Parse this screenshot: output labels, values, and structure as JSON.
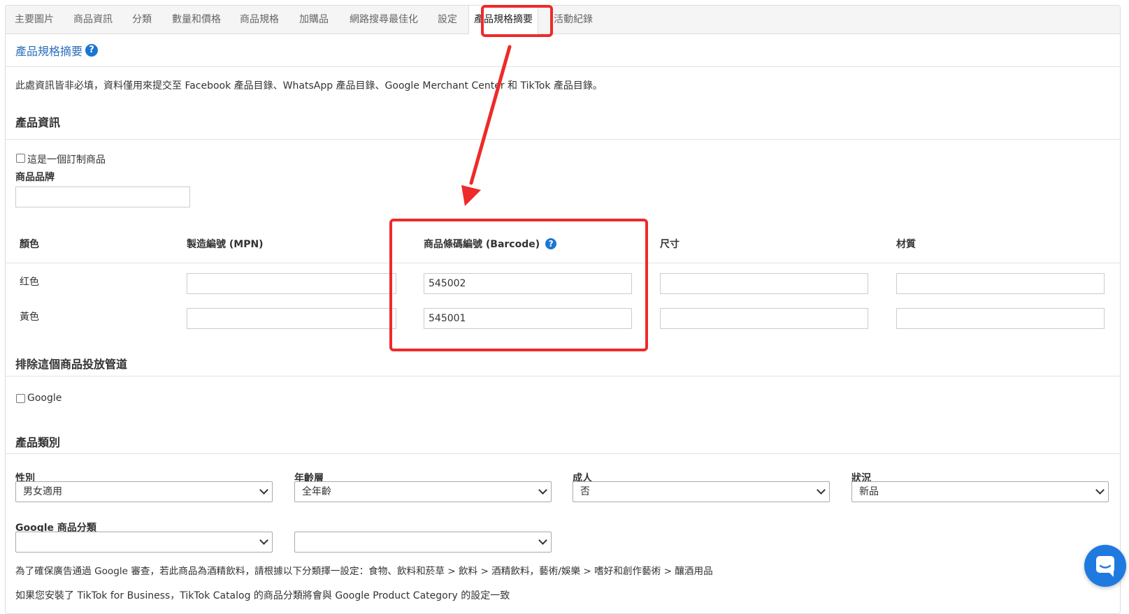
{
  "tabs": [
    {
      "label": "主要圖片"
    },
    {
      "label": "商品資訊"
    },
    {
      "label": "分類"
    },
    {
      "label": "數量和價格"
    },
    {
      "label": "商品規格"
    },
    {
      "label": "加購品"
    },
    {
      "label": "網路搜尋最佳化"
    },
    {
      "label": "設定"
    },
    {
      "label": "產品規格摘要",
      "active": true
    },
    {
      "label": "活動紀錄"
    }
  ],
  "panel_title": "產品規格摘要",
  "notice": "此處資訊皆非必填，資料僅用來提交至 Facebook 產品目錄、WhatsApp 產品目錄、Google Merchant Center 和 TikTok 產品目錄。",
  "product_info": {
    "heading": "產品資訊",
    "custom_product_label": "這是一個訂制商品",
    "brand_label": "商品品牌",
    "brand_value": ""
  },
  "variants_table": {
    "headers": {
      "color": "顏色",
      "mpn": "製造編號 (MPN)",
      "barcode": "商品條碼編號 (Barcode)",
      "size": "尺寸",
      "material": "材質"
    },
    "rows": [
      {
        "color": "红色",
        "mpn": "",
        "barcode": "545002",
        "size": "",
        "material": ""
      },
      {
        "color": "黃色",
        "mpn": "",
        "barcode": "545001",
        "size": "",
        "material": ""
      }
    ]
  },
  "exclude_channels": {
    "heading": "排除這個商品投放管道",
    "google_label": "Google"
  },
  "product_category": {
    "heading": "產品類別",
    "gender": {
      "label": "性別",
      "value": "男女適用"
    },
    "age_group": {
      "label": "年齡層",
      "value": "全年齡"
    },
    "adult": {
      "label": "成人",
      "value": "否"
    },
    "condition": {
      "label": "狀況",
      "value": "新品"
    },
    "google_category": {
      "label": "Google 商品分類",
      "value1": "",
      "value2": ""
    },
    "note1": "為了確保廣告通過 Google 審查，若此商品為酒精飲料，請根據以下分類擇一設定：食物、飲料和菸草 > 飲料 > 酒精飲料，藝術/娛樂 > 嗜好和創作藝術 > 釀酒用品",
    "note2": "如果您安裝了 TikTok for Business，TikTok Catalog 的商品分類將會與 Google Product Category 的設定一致"
  },
  "help_icon_glyph": "?",
  "colors": {
    "annotation_red": "#ee2a2a",
    "link_blue": "#2a6ebb",
    "help_blue": "#1a76d2",
    "chat_blue": "#1f7ae0"
  }
}
